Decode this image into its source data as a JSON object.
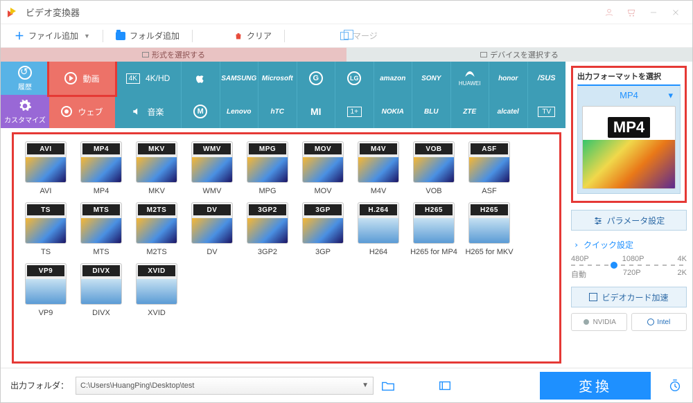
{
  "app_title": "ビデオ変換器",
  "toolbar": {
    "add_file": "ファイル追加",
    "add_folder": "フォルダ追加",
    "clear": "クリア",
    "merge": "マージ"
  },
  "subtabs": {
    "format_tab": "形式を選択する",
    "device_tab": "デバイスを選択する"
  },
  "sidebar": {
    "history": "履歴",
    "customize": "カスタマイズ"
  },
  "categories": {
    "video": "動画",
    "web": "ウェブ",
    "hd": "4K/HD",
    "audio": "音楽"
  },
  "brands_row1": [
    "Apple",
    "SAMSUNG",
    "Microsoft",
    "G",
    "LG",
    "amazon",
    "SONY",
    "HUAWEI",
    "honor",
    "ASUS"
  ],
  "brands_row2": [
    "Moto",
    "Lenovo",
    "hTC",
    "MI",
    "OnePlus",
    "NOKIA",
    "BLU",
    "ZTE",
    "alcatel",
    "TV"
  ],
  "formats": [
    {
      "badge": "AVI",
      "label": "AVI"
    },
    {
      "badge": "MP4",
      "label": "MP4"
    },
    {
      "badge": "MKV",
      "label": "MKV"
    },
    {
      "badge": "WMV",
      "label": "WMV"
    },
    {
      "badge": "MPG",
      "label": "MPG"
    },
    {
      "badge": "MOV",
      "label": "MOV"
    },
    {
      "badge": "M4V",
      "label": "M4V"
    },
    {
      "badge": "VOB",
      "label": "VOB"
    },
    {
      "badge": "ASF",
      "label": "ASF"
    },
    {
      "badge": "TS",
      "label": "TS"
    },
    {
      "badge": "MTS",
      "label": "MTS"
    },
    {
      "badge": "M2TS",
      "label": "M2TS"
    },
    {
      "badge": "DV",
      "label": "DV"
    },
    {
      "badge": "3GP2",
      "label": "3GP2"
    },
    {
      "badge": "3GP",
      "label": "3GP"
    },
    {
      "badge": "H.264",
      "label": "H264",
      "enc": true
    },
    {
      "badge": "H265",
      "label": "H265 for MP4",
      "enc": true
    },
    {
      "badge": "H265",
      "label": "H265 for MKV",
      "enc": true
    },
    {
      "badge": "VP9",
      "label": "VP9",
      "enc": true
    },
    {
      "badge": "DIVX",
      "label": "DIVX",
      "enc": true
    },
    {
      "badge": "XVID",
      "label": "XVID",
      "enc": true
    }
  ],
  "right_panel": {
    "title": "出力フォーマットを選択",
    "selected": "MP4",
    "preview_badge": "MP4",
    "param_settings": "パラメータ設定",
    "quick_setting": "クイック設定",
    "presets_top": [
      "480P",
      "1080P",
      "4K"
    ],
    "presets_bottom": [
      "自動",
      "720P",
      "2K"
    ],
    "gpu_accel": "ビデオカード加速",
    "chips": [
      "NVIDIA",
      "Intel"
    ]
  },
  "bottom": {
    "output_label": "出力フォルダ：",
    "output_path": "C:\\Users\\HuangPing\\Desktop\\test",
    "convert": "変換"
  }
}
